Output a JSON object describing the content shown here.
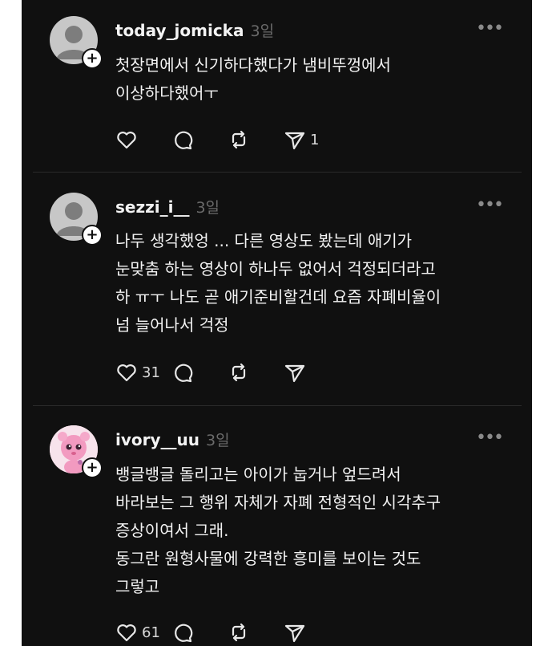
{
  "posts": [
    {
      "username": "today_jomicka",
      "time": "3일",
      "more": "•••",
      "text": "첫장면에서 신기하다했다가 냄비뚜껑에서\n이상하다했어ㅜ",
      "likes": "",
      "shares": "1",
      "avatar_icon": "default-user-icon"
    },
    {
      "username": "sezzi_i__",
      "time": "3일",
      "more": "•••",
      "text": "나두 생각했엉 ... 다른 영상도 봤는데 애기가\n눈맞춤 하는 영상이 하나두 없어서 걱정되더라고\n하 ㅠㅜ 나도 곧 애기준비할건데 요즘 자폐비율이\n넘 늘어나서 걱정",
      "likes": "31",
      "shares": "",
      "avatar_icon": "default-user-icon"
    },
    {
      "username": "ivory__uu",
      "time": "3일",
      "more": "•••",
      "text": "뱅글뱅글 돌리고는 아이가 눕거나 엎드려서\n바라보는 그 행위 자체가 자폐 전형적인 시각추구\n증상이여서 그래.\n동그란 원형사물에 강력한 흥미를 보이는 것도\n그렇고",
      "likes": "61",
      "shares": "",
      "avatar_icon": "pink-character-avatar"
    }
  ],
  "icons": {
    "add": "+",
    "heart": "heart-icon",
    "comment": "comment-icon",
    "repost": "repost-icon",
    "share": "share-icon"
  },
  "colors": {
    "background": "#101010",
    "text": "#f3f3f3",
    "muted": "#6a6a6a",
    "divider": "#2a2a2a"
  }
}
